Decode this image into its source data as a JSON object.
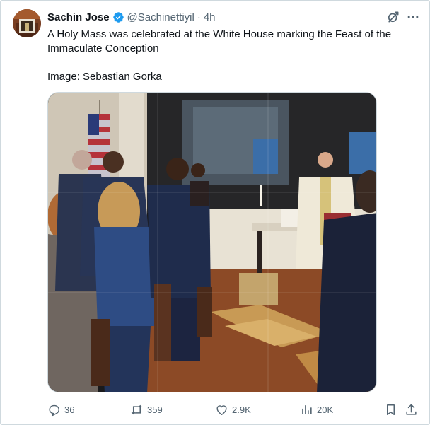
{
  "tweet": {
    "author_name": "Sachin Jose",
    "author_handle": "@Sachinettiyil",
    "separator": "·",
    "timestamp": "4h",
    "text_line1": "A Holy Mass was celebrated at the White House marking the Feast of the Immaculate Conception",
    "text_line2": "Image: Sebastian Gorka"
  },
  "actions": {
    "replies": "36",
    "reposts": "359",
    "likes": "2.9K",
    "views": "20K"
  },
  "icons": {
    "verified": "verified-badge-icon",
    "grok": "grok-icon",
    "more": "more-icon",
    "reply": "reply-icon",
    "repost": "repost-icon",
    "like": "heart-icon",
    "views": "views-icon",
    "bookmark": "bookmark-icon",
    "share": "share-icon"
  },
  "colors": {
    "verified": "#1d9bf0",
    "text": "#0f1419",
    "secondary": "#536471",
    "border": "#cfd9de"
  }
}
